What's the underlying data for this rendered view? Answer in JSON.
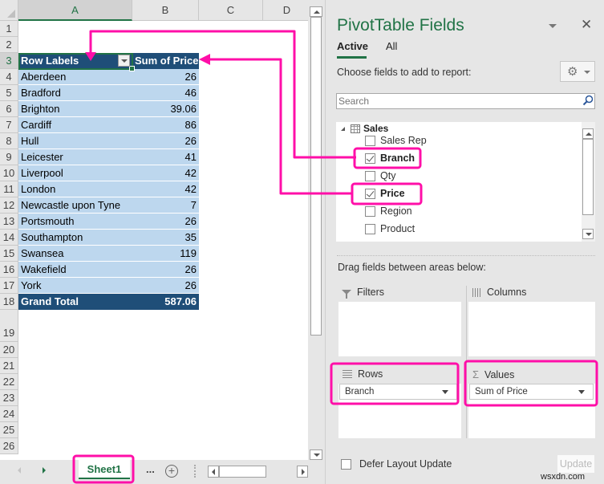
{
  "spreadsheet": {
    "columns": [
      "A",
      "B",
      "C",
      "D"
    ],
    "row_numbers": [
      "1",
      "2",
      "3",
      "4",
      "5",
      "6",
      "7",
      "8",
      "9",
      "10",
      "11",
      "12",
      "13",
      "14",
      "15",
      "16",
      "17",
      "18",
      "19",
      "20",
      "21",
      "22",
      "23",
      "24",
      "25",
      "26"
    ],
    "pivot": {
      "header": {
        "row_labels": "Row Labels",
        "value_header": "Sum of Price"
      },
      "rows": [
        {
          "label": "Aberdeen",
          "value": "26"
        },
        {
          "label": "Bradford",
          "value": "46"
        },
        {
          "label": "Brighton",
          "value": "39.06"
        },
        {
          "label": "Cardiff",
          "value": "86"
        },
        {
          "label": "Hull",
          "value": "26"
        },
        {
          "label": "Leicester",
          "value": "41"
        },
        {
          "label": "Liverpool",
          "value": "42"
        },
        {
          "label": "London",
          "value": "42"
        },
        {
          "label": "Newcastle upon Tyne",
          "value": "7"
        },
        {
          "label": "Portsmouth",
          "value": "26"
        },
        {
          "label": "Southampton",
          "value": "35"
        },
        {
          "label": "Swansea",
          "value": "119"
        },
        {
          "label": "Wakefield",
          "value": "26"
        },
        {
          "label": "York",
          "value": "26"
        }
      ],
      "grand_total": {
        "label": "Grand Total",
        "value": "587.06"
      }
    },
    "sheet_tab": "Sheet1",
    "more_tabs": "...",
    "add_sheet": "+"
  },
  "panel": {
    "title": "PivotTable Fields",
    "close": "✕",
    "tabs": {
      "active": "Active",
      "all": "All"
    },
    "choose_label": "Choose fields to add to report:",
    "gear": "⚙",
    "search_placeholder": "Search",
    "table_name": "Sales",
    "fields": [
      {
        "label": "Sales Rep",
        "checked": false
      },
      {
        "label": "Branch",
        "checked": true
      },
      {
        "label": "Qty",
        "checked": false
      },
      {
        "label": "Price",
        "checked": true
      },
      {
        "label": "Region",
        "checked": false
      },
      {
        "label": "Product",
        "checked": false
      }
    ],
    "drag_label": "Drag fields between areas below:",
    "areas": {
      "filters": {
        "label": "Filters"
      },
      "columns": {
        "label": "Columns"
      },
      "rows": {
        "label": "Rows",
        "item": "Branch"
      },
      "values": {
        "label": "Values",
        "item": "Sum of Price",
        "icon": "Σ"
      }
    },
    "defer_label": "Defer Layout Update",
    "update_label": "Update"
  },
  "watermark": "wsxdn.com",
  "colors": {
    "accent_green": "#217346",
    "pivot_header": "#1f4e78",
    "pivot_body": "#bdd7ee",
    "highlight_magenta": "#ff0fa8"
  }
}
